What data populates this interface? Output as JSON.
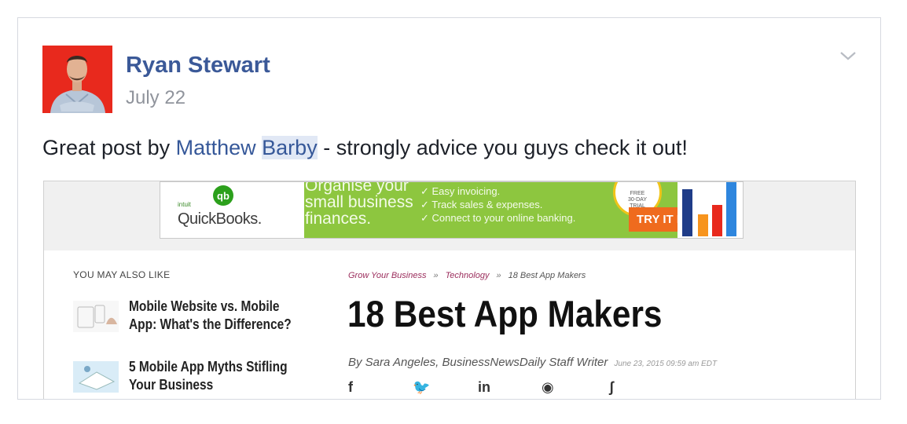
{
  "post": {
    "author": "Ryan Stewart",
    "date": "July 22",
    "text_before": "Great post by ",
    "mention_first": "Matthew",
    "mention_last": "Barby",
    "text_after": " - strongly advice you guys check it out!",
    "options_icon": "chevron-down-icon"
  },
  "ad": {
    "brand_small": "intuit",
    "brand": "QuickBooks.",
    "headline": [
      "Organise your",
      "small business",
      "finances."
    ],
    "bullets": [
      "✓ Easy invoicing.",
      "✓ Track sales & expenses.",
      "✓ Connect to your online banking."
    ],
    "badge": [
      "FREE",
      "30-DAY",
      "TRIAL"
    ],
    "cta": "TRY IT FREE ›",
    "colors": {
      "green": "#8dc63f",
      "orange": "#ef6b1e"
    }
  },
  "article": {
    "sidebar_heading": "YOU MAY ALSO LIKE",
    "related": [
      {
        "title_line1": "Mobile Website vs. Mobile",
        "title_line2": "App: What's the Difference?"
      },
      {
        "title_line1": "5 Mobile App Myths Stifling",
        "title_line2": "Your Business"
      }
    ],
    "breadcrumb": [
      "Grow Your Business",
      "Technology",
      "18 Best App Makers"
    ],
    "breadcrumb_separator": "»",
    "title": "18 Best App Makers",
    "byline": "By Sara Angeles, BusinessNewsDaily Staff Writer",
    "timestamp": "June 23, 2015 09:59 am EDT",
    "share": [
      {
        "icon": "facebook-icon",
        "glyph": "f"
      },
      {
        "icon": "twitter-icon",
        "glyph": "🐦"
      },
      {
        "icon": "linkedin-icon",
        "glyph": "in"
      },
      {
        "icon": "reddit-icon",
        "glyph": "◉"
      },
      {
        "icon": "stumbleupon-icon",
        "glyph": "ʃ"
      }
    ]
  }
}
